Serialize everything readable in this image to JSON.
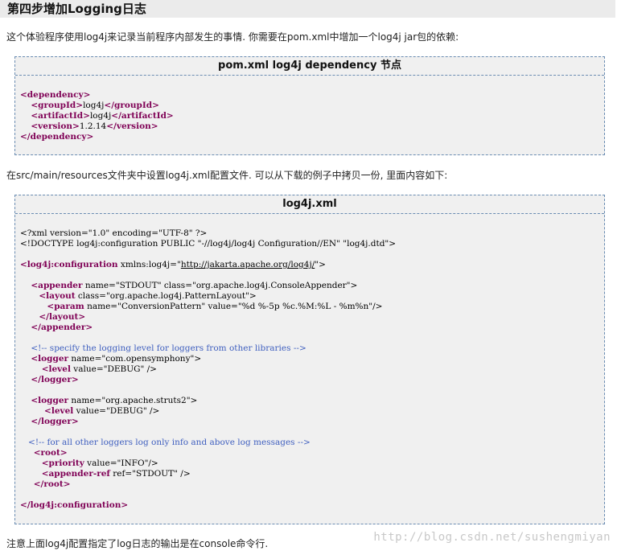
{
  "heading": "第四步增加Logging日志",
  "intro": "这个体验程序使用log4j来记录当前程序内部发生的事情. 你需要在pom.xml中增加一个log4j jar包的依赖:",
  "panel1": {
    "title": "pom.xml log4j dependency 节点",
    "lines": [
      {
        "indent": "",
        "parts": [
          {
            "c": "t",
            "v": "<dependency>"
          }
        ]
      },
      {
        "indent": "    ",
        "parts": [
          {
            "c": "t",
            "v": "<groupId>"
          },
          {
            "c": "",
            "v": "log4j"
          },
          {
            "c": "t",
            "v": "</groupId>"
          }
        ]
      },
      {
        "indent": "    ",
        "parts": [
          {
            "c": "t",
            "v": "<artifactId>"
          },
          {
            "c": "",
            "v": "log4j"
          },
          {
            "c": "t",
            "v": "</artifactId>"
          }
        ]
      },
      {
        "indent": "    ",
        "parts": [
          {
            "c": "t",
            "v": "<version>"
          },
          {
            "c": "",
            "v": "1.2.14"
          },
          {
            "c": "t",
            "v": "</version>"
          }
        ]
      },
      {
        "indent": "",
        "parts": [
          {
            "c": "t",
            "v": "</dependency>"
          }
        ]
      }
    ]
  },
  "middle": "在src/main/resources文件夹中设置log4j.xml配置文件. 可以从下载的例子中拷贝一份, 里面内容如下:",
  "panel2": {
    "title": "log4j.xml",
    "lines": [
      {
        "indent": "",
        "parts": [
          {
            "c": "",
            "v": "<?xml version=\"1.0\" encoding=\"UTF-8\" ?>"
          }
        ]
      },
      {
        "indent": "",
        "parts": [
          {
            "c": "",
            "v": "<!DOCTYPE log4j:configuration PUBLIC \"-//log4j/log4j Configuration//EN\" \"log4j.dtd\">"
          }
        ]
      },
      {
        "indent": "",
        "parts": []
      },
      {
        "indent": "",
        "parts": [
          {
            "c": "t",
            "v": "<log4j:configuration"
          },
          {
            "c": "",
            "v": " xmlns:log4j=\""
          },
          {
            "c": "lk",
            "v": "http://jakarta.apache.org/log4j/"
          },
          {
            "c": "",
            "v": "\">"
          }
        ]
      },
      {
        "indent": "",
        "parts": []
      },
      {
        "indent": "    ",
        "parts": [
          {
            "c": "t",
            "v": "<appender"
          },
          {
            "c": "",
            "v": " name=\"STDOUT\" class=\"org.apache.log4j.ConsoleAppender\">"
          }
        ]
      },
      {
        "indent": "       ",
        "parts": [
          {
            "c": "t",
            "v": "<layout"
          },
          {
            "c": "",
            "v": " class=\"org.apache.log4j.PatternLayout\">"
          }
        ]
      },
      {
        "indent": "          ",
        "parts": [
          {
            "c": "t",
            "v": "<param"
          },
          {
            "c": "",
            "v": " name=\"ConversionPattern\" value=\"%d %-5p %c.%M:%L - %m%n\"/>"
          }
        ]
      },
      {
        "indent": "       ",
        "parts": [
          {
            "c": "t",
            "v": "</layout>"
          }
        ]
      },
      {
        "indent": "    ",
        "parts": [
          {
            "c": "t",
            "v": "</appender>"
          }
        ]
      },
      {
        "indent": "",
        "parts": []
      },
      {
        "indent": "    ",
        "parts": [
          {
            "c": "cm",
            "v": "<!-- specify the logging level for loggers from other libraries -->"
          }
        ]
      },
      {
        "indent": "    ",
        "parts": [
          {
            "c": "t",
            "v": "<logger"
          },
          {
            "c": "",
            "v": " name=\"com.opensymphony\">"
          }
        ]
      },
      {
        "indent": "        ",
        "parts": [
          {
            "c": "t",
            "v": "<level"
          },
          {
            "c": "",
            "v": " value=\"DEBUG\" />"
          }
        ]
      },
      {
        "indent": "    ",
        "parts": [
          {
            "c": "t",
            "v": "</logger>"
          }
        ]
      },
      {
        "indent": "",
        "parts": []
      },
      {
        "indent": "    ",
        "parts": [
          {
            "c": "t",
            "v": "<logger"
          },
          {
            "c": "",
            "v": " name=\"org.apache.struts2\">"
          }
        ]
      },
      {
        "indent": "         ",
        "parts": [
          {
            "c": "t",
            "v": "<level"
          },
          {
            "c": "",
            "v": " value=\"DEBUG\" />"
          }
        ]
      },
      {
        "indent": "    ",
        "parts": [
          {
            "c": "t",
            "v": "</logger>"
          }
        ]
      },
      {
        "indent": "",
        "parts": []
      },
      {
        "indent": "   ",
        "parts": [
          {
            "c": "cm",
            "v": "<!-- for all other loggers log only info and above log messages -->"
          }
        ]
      },
      {
        "indent": "     ",
        "parts": [
          {
            "c": "t",
            "v": "<root>"
          }
        ]
      },
      {
        "indent": "        ",
        "parts": [
          {
            "c": "t",
            "v": "<priority"
          },
          {
            "c": "",
            "v": " value=\"INFO\"/>"
          }
        ]
      },
      {
        "indent": "        ",
        "parts": [
          {
            "c": "t",
            "v": "<appender-ref"
          },
          {
            "c": "",
            "v": " ref=\"STDOUT\" />"
          }
        ]
      },
      {
        "indent": "     ",
        "parts": [
          {
            "c": "t",
            "v": "</root>"
          }
        ]
      },
      {
        "indent": "",
        "parts": []
      },
      {
        "indent": "",
        "parts": [
          {
            "c": "t",
            "v": "</log4j:configuration>"
          }
        ]
      }
    ]
  },
  "footer": "注意上面log4j配置指定了log日志的输出是在console命令行.",
  "watermark": "http://blog.csdn.net/sushengmiyan"
}
